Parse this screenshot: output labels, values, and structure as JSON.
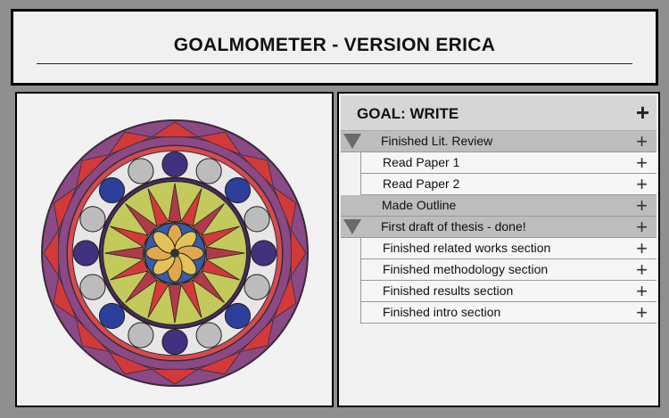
{
  "header": {
    "title": "GOALMOMETER - VERSION ERICA"
  },
  "goal": {
    "title": "GOAL: WRITE",
    "add_symbol": "+"
  },
  "items": [
    {
      "label": "Finished Lit. Review",
      "level": "parent",
      "collapse_toggle": true
    },
    {
      "label": "Read Paper 1",
      "level": "child"
    },
    {
      "label": "Read Paper 2",
      "level": "child"
    },
    {
      "label": "Made Outline",
      "level": "parent",
      "collapse_toggle": false
    },
    {
      "label": "First draft of thesis - done!",
      "level": "parent",
      "collapse_toggle": true
    },
    {
      "label": "Finished related works section",
      "level": "child"
    },
    {
      "label": "Finished methodology section",
      "level": "child"
    },
    {
      "label": "Finished results section",
      "level": "child"
    },
    {
      "label": "Finished intro section",
      "level": "child"
    }
  ],
  "item_add_symbol": "+",
  "mandala": {
    "icon": "mandala-drawing-image",
    "colors": {
      "outer": "#8a4a86",
      "red": "#d23a3a",
      "blue": "#2d3f9a",
      "purple": "#43307f",
      "green": "#c3c95a",
      "yellow": "#e3c25a",
      "gray": "#bcbcbc"
    }
  }
}
